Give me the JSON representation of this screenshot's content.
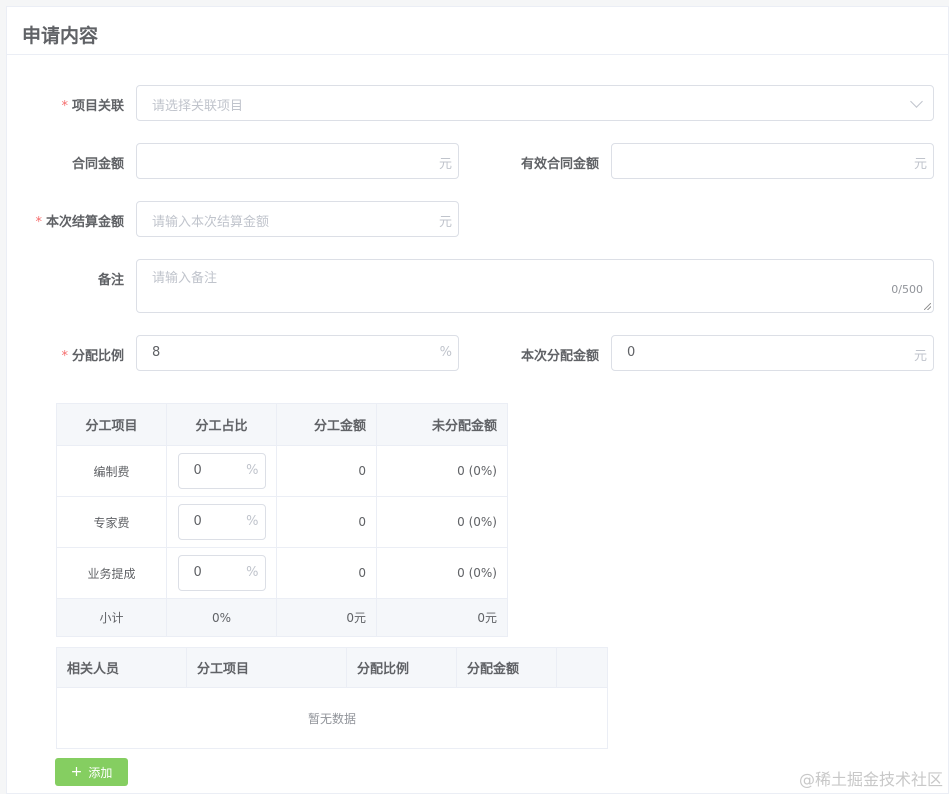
{
  "card": {
    "title": "申请内容"
  },
  "form": {
    "project": {
      "label": "项目关联",
      "required": "*",
      "placeholder": "请选择关联项目"
    },
    "contract_amount": {
      "label": "合同金额",
      "value": "",
      "suffix": "元"
    },
    "effective_amount": {
      "label": "有效合同金额",
      "value": "",
      "suffix": "元"
    },
    "settle_amount": {
      "label": "本次结算金额",
      "required": "*",
      "placeholder": "请输入本次结算金额",
      "suffix": "元"
    },
    "remark": {
      "label": "备注",
      "placeholder": "请输入备注",
      "count": "0/500"
    },
    "ratio": {
      "label": "分配比例",
      "required": "*",
      "value": "8",
      "suffix": "%"
    },
    "alloc_amount": {
      "label": "本次分配金额",
      "value": "0",
      "suffix": "元"
    }
  },
  "split_table": {
    "headers": [
      "分工项目",
      "分工占比",
      "分工金额",
      "未分配金额"
    ],
    "rows": [
      {
        "item": "编制费",
        "ratio": "0",
        "ratio_suffix": "%",
        "amount": "0",
        "unallocated": "0 (0%)"
      },
      {
        "item": "专家费",
        "ratio": "0",
        "ratio_suffix": "%",
        "amount": "0",
        "unallocated": "0 (0%)"
      },
      {
        "item": "业务提成",
        "ratio": "0",
        "ratio_suffix": "%",
        "amount": "0",
        "unallocated": "0 (0%)"
      }
    ],
    "subtotal": {
      "label": "小计",
      "ratio": "0%",
      "amount": "0元",
      "unallocated": "0元"
    }
  },
  "people_table": {
    "headers": [
      "相关人员",
      "分工项目",
      "分配比例",
      "分配金额",
      ""
    ],
    "empty_text": "暂无数据"
  },
  "add_button": {
    "icon": "+",
    "label": "添加"
  },
  "watermark": "@稀土掘金技术社区",
  "colors": {
    "required": "#f56c6c",
    "success": "#85ce61",
    "border": "#dcdfe6"
  }
}
